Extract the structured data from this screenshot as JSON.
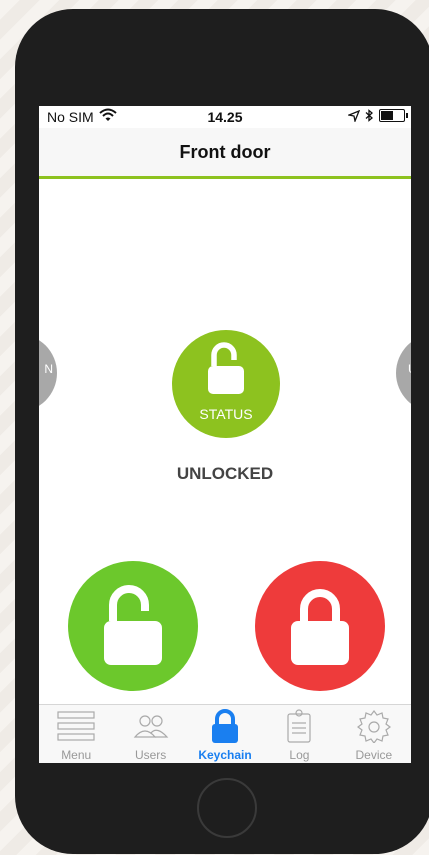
{
  "statusbar": {
    "carrier": "No SIM",
    "wifi_icon": "wifi-icon",
    "time": "14.25",
    "location_icon": "location-arrow-icon",
    "bluetooth_icon": "bluetooth-icon",
    "battery_icon": "battery-icon"
  },
  "navbar": {
    "title": "Front door"
  },
  "side_left": {
    "label": "N"
  },
  "side_right": {
    "label": "U"
  },
  "status": {
    "label": "STATUS",
    "state": "UNLOCKED",
    "icon": "unlocked-padlock-icon"
  },
  "actions": {
    "unlock": {
      "icon": "unlocked-padlock-icon",
      "color": "#6cc82c"
    },
    "lock": {
      "icon": "locked-padlock-icon",
      "color": "#ee3b3b"
    }
  },
  "tabs": [
    {
      "label": "Menu",
      "icon": "menu-icon"
    },
    {
      "label": "Users",
      "icon": "users-icon"
    },
    {
      "label": "Keychain",
      "icon": "padlock-icon",
      "active": true
    },
    {
      "label": "Log",
      "icon": "clipboard-icon"
    },
    {
      "label": "Device",
      "icon": "gear-icon"
    }
  ],
  "colors": {
    "accent_green": "#8dc21f",
    "active_blue": "#1a7ff0",
    "lock_red": "#ee3b3b"
  }
}
